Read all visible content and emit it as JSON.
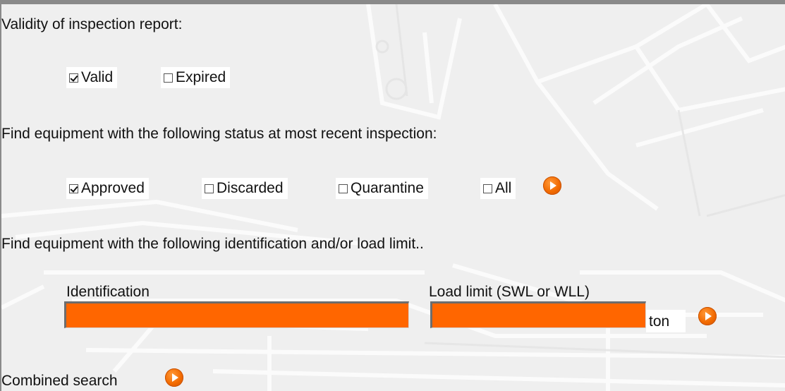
{
  "validity": {
    "heading": "Validity of inspection report:",
    "options": [
      {
        "label": "Valid",
        "checked": true
      },
      {
        "label": "Expired",
        "checked": false
      }
    ]
  },
  "status": {
    "heading": "Find equipment with the following status at most recent inspection:",
    "options": [
      {
        "label": "Approved",
        "checked": true
      },
      {
        "label": "Discarded",
        "checked": false
      },
      {
        "label": "Quarantine",
        "checked": false
      },
      {
        "label": "All",
        "checked": false
      }
    ]
  },
  "identification_search": {
    "heading": "Find equipment with the following identification and/or load limit..",
    "identification_label": "Identification",
    "identification_value": "",
    "load_limit_label": "Load limit (SWL or WLL)",
    "load_limit_value": "",
    "unit": "ton"
  },
  "combined": {
    "label": "Combined search"
  },
  "colors": {
    "accent": "#ff6600",
    "background": "#efefef",
    "frame_border": "#8a8a8a"
  },
  "icons": {
    "go_button": "orange-circle-arrow-icon"
  }
}
